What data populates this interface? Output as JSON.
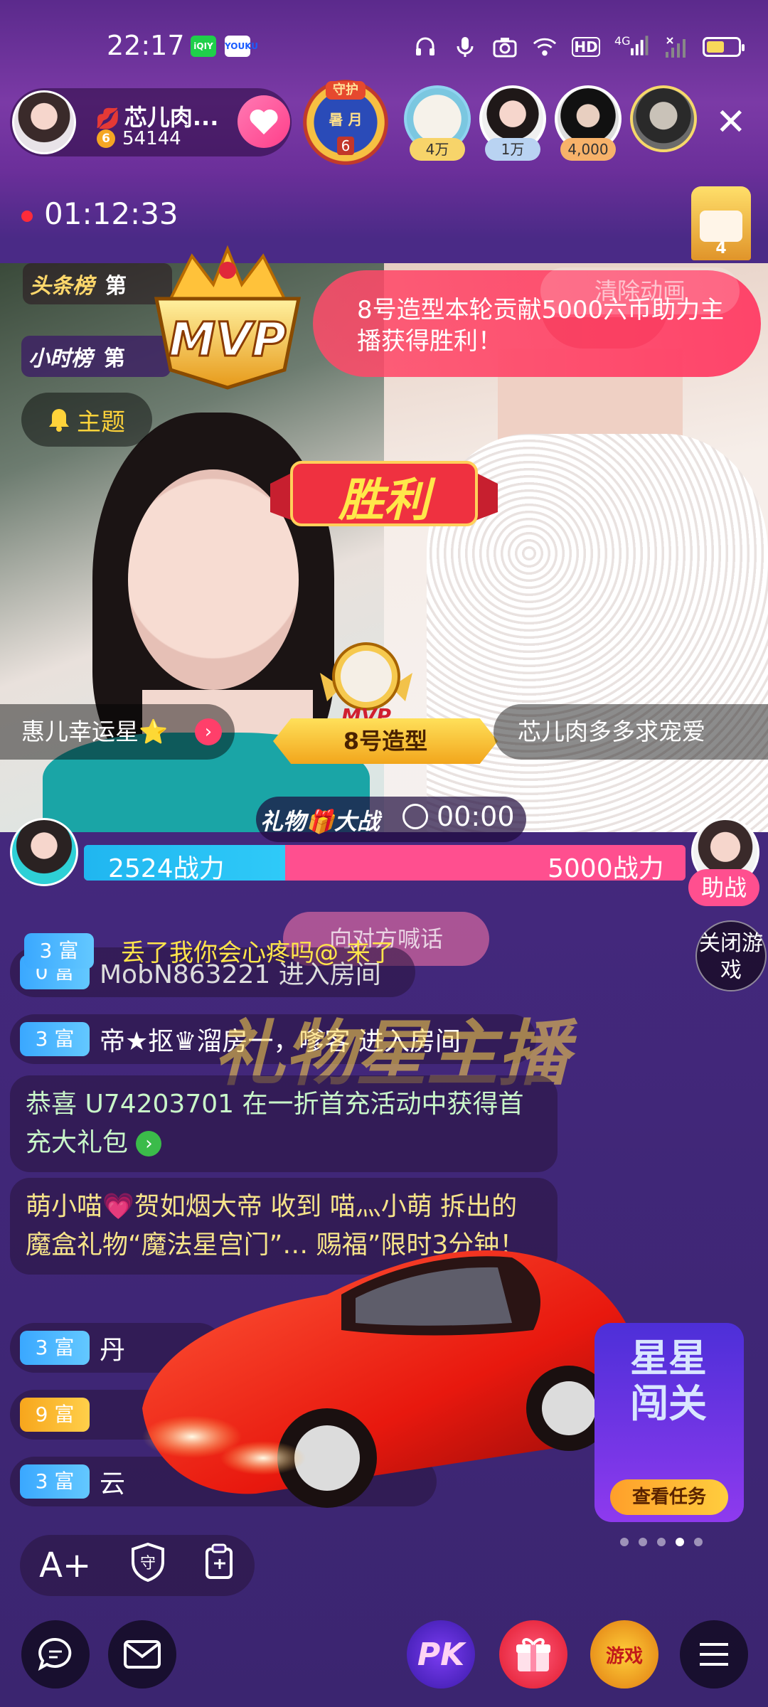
{
  "status_bar": {
    "time": "22:17",
    "app_icon_1": "iQIY",
    "app_icon_2": "YOUKU",
    "icons": [
      "headphones-icon",
      "mic-icon",
      "camera-icon",
      "wifi-icon",
      "hd-icon",
      "signal-icon",
      "battery-icon"
    ],
    "hd_label": "HD",
    "network_label": "4G"
  },
  "host": {
    "name": "芯儿肉...",
    "level": "6",
    "fans": "54144",
    "follow_icon": "heart-icon"
  },
  "guard_badge": {
    "label": "守护",
    "text": "暑 月",
    "count": "6"
  },
  "viewers": [
    {
      "tag": "4万",
      "tag_color": "#f7d46a"
    },
    {
      "tag": "1万",
      "tag_color": "#b9d3f2"
    },
    {
      "tag": "4,000",
      "tag_color": "#f7b26a"
    },
    {
      "tag": "",
      "tag_color": ""
    }
  ],
  "live_timer": "01:12:33",
  "throne_count": "4",
  "boards": {
    "headline": "头条榜",
    "headline_rank": "第",
    "hourly": "小时榜",
    "hourly_rank": "第"
  },
  "mvp": {
    "crown_text": "MVP",
    "banner_text": "8号造型本轮贡献5000六币助力主播获得胜利！",
    "clear_anim": "清除动画"
  },
  "topic_button": "主题",
  "victory_text": "胜利",
  "team_left": "惠儿幸运星⭐",
  "mvp_badge": "MVP",
  "mvp_name": "8号造型",
  "team_right": "芯儿肉多多求宠爱",
  "gift_war": {
    "title": "礼物🎁大战",
    "time": "00:00"
  },
  "pk": {
    "left_power": "2524战力",
    "right_power": "5000战力",
    "left_ratio": 0.335,
    "assist": "助战"
  },
  "shout_button": "向对方喊话",
  "close_game": "关闭游戏",
  "float_message": "丢了我你会心疼吗@ 来了",
  "chat": {
    "line1_badge": "0 富",
    "line1_text": "MobN863221 进入房间",
    "line1_overlay_badge": "3 富",
    "line2_badge": "3 富",
    "line2_text": "帝★抠♛溜房一，嗲客 进入房间",
    "line3_text": "恭喜 U74203701 在一折首充活动中获得首充大礼包",
    "line4_text": "萌小喵💗贺如烟大帝 收到 喵灬小萌 拆出的魔盒礼物“魔法星宫门”… 赐福”限时3分钟！",
    "line5_badge": "3 富",
    "line5_text": "丹",
    "line6_badge": "9 富",
    "line6_text": "",
    "line7_badge": "3 富",
    "line7_text": "云"
  },
  "gift_anchor_title": "礼物星主播",
  "star_quest": {
    "title": "星星闯关",
    "button": "查看任务"
  },
  "tool_row": {
    "font_icon": "A+",
    "guard_icon": "守",
    "clip_icon": "clipboard-icon"
  },
  "bottom_bar": {
    "chat_icon": "chat-bubble-icon",
    "mail_icon": "mail-icon",
    "pk_label": "PK",
    "gift_icon": "gift-icon",
    "game_label": "游戏",
    "menu_icon": "menu-icon"
  }
}
